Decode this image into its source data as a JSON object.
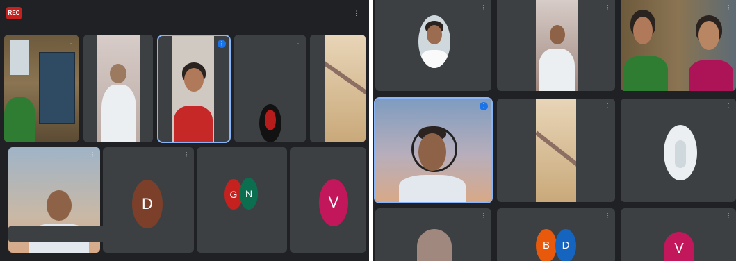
{
  "meeting": {
    "rec_label": "REC",
    "title": "",
    "more_label": "⋮"
  },
  "left_tiles": [
    {
      "name": "",
      "mic": "⋮"
    },
    {
      "name": "",
      "mic": ""
    },
    {
      "name": "",
      "mic": "⋮"
    },
    {
      "name": "",
      "mic": "⋮"
    },
    {
      "name": "",
      "mic": ""
    },
    {
      "name": "",
      "mic": "⋮"
    },
    {
      "name": "",
      "mic": "⋮",
      "avatar_letter": "D",
      "avatar_color": "#7b3f2a"
    },
    {
      "name": "",
      "mic": "",
      "avatar_letter_1": "G",
      "avatar_color_1": "#c5221f",
      "avatar_letter_2": "N",
      "avatar_color_2": "#0b6e4f"
    },
    {
      "name": "",
      "mic": "",
      "avatar_letter": "V",
      "avatar_color": "#c2185b"
    }
  ],
  "right_tiles": [
    {
      "name": "",
      "mic": "⋮"
    },
    {
      "name": "",
      "mic": "⋮"
    },
    {
      "name": "",
      "mic": "⋮"
    },
    {
      "name": "",
      "mic": "⋮"
    },
    {
      "name": "",
      "mic": "⋮"
    },
    {
      "name": "",
      "mic": "⋮"
    },
    {
      "name": "",
      "mic": "⋮"
    },
    {
      "name": "",
      "mic": "⋮",
      "avatar_letter_1": "B",
      "avatar_color_1": "#e8590c",
      "avatar_letter_2": "D",
      "avatar_color_2": "#1565c0"
    },
    {
      "name": "",
      "mic": "⋮",
      "avatar_letter": "V",
      "avatar_color": "#c2185b"
    }
  ],
  "colors": {
    "background": "#202124",
    "tile": "#3c4043",
    "active_border": "#8ab4f8",
    "record": "#c5221f"
  }
}
